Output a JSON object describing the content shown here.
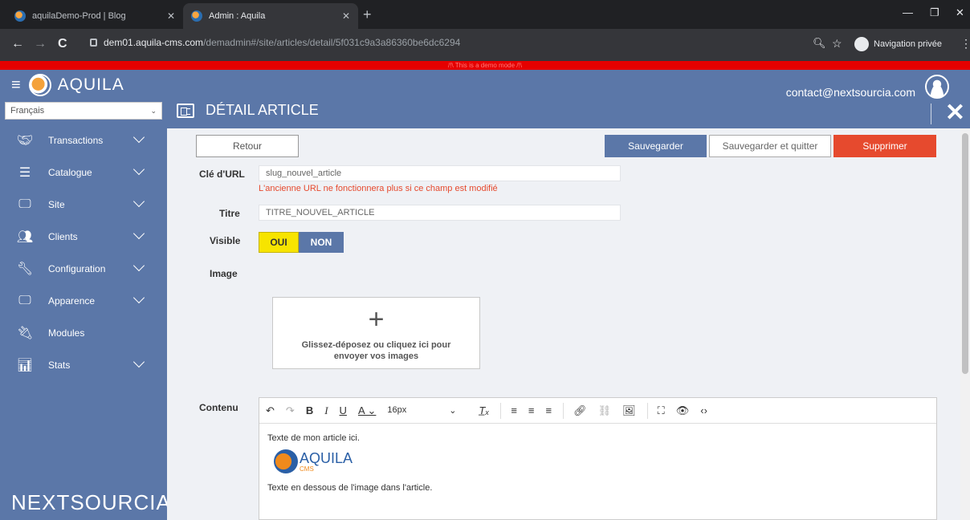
{
  "browser": {
    "tabs": [
      {
        "title": "aquilaDemo-Prod | Blog"
      },
      {
        "title": "Admin : Aquila"
      }
    ],
    "url_host": "dem01.aquila-cms.com",
    "url_path": "/demadmin#/site/articles/detail/5f031c9a3a86360be6dc6294",
    "private_label": "Navigation privée"
  },
  "demo_banner": "/!\\ This is a demo mode /!\\",
  "sidebar": {
    "brand": "AQUILA",
    "language": "Français",
    "items": [
      {
        "label": "Transactions",
        "expandable": true
      },
      {
        "label": "Catalogue",
        "expandable": true
      },
      {
        "label": "Site",
        "expandable": true
      },
      {
        "label": "Clients",
        "expandable": true
      },
      {
        "label": "Configuration",
        "expandable": true
      },
      {
        "label": "Apparence",
        "expandable": true
      },
      {
        "label": "Modules",
        "expandable": false
      },
      {
        "label": "Stats",
        "expandable": true
      }
    ],
    "footer_logo": "NEXTSOURCIA"
  },
  "header": {
    "email": "contact@nextsourcia.com",
    "page_title": "DÉTAIL ARTICLE"
  },
  "actions": {
    "back": "Retour",
    "save": "Sauvegarder",
    "save_quit": "Sauvegarder et quitter",
    "delete": "Supprimer"
  },
  "form": {
    "url_key_label": "Clé d'URL",
    "url_key_value": "slug_nouvel_article",
    "url_warning": "L'ancienne URL ne fonctionnera plus si ce champ est modifié",
    "title_label": "Titre",
    "title_value": "TITRE_NOUVEL_ARTICLE",
    "visible_label": "Visible",
    "visible_on": "OUI",
    "visible_off": "NON",
    "image_label": "Image",
    "dropzone_text": "Glissez-déposez ou cliquez ici pour envoyer vos images",
    "content_label": "Contenu",
    "font_size": "16px",
    "content_line1": "Texte de mon article ici.",
    "content_logo_text": "AQUILA",
    "content_logo_sub": "CMS",
    "content_line2": "Texte en dessous de l'image dans l'article."
  }
}
